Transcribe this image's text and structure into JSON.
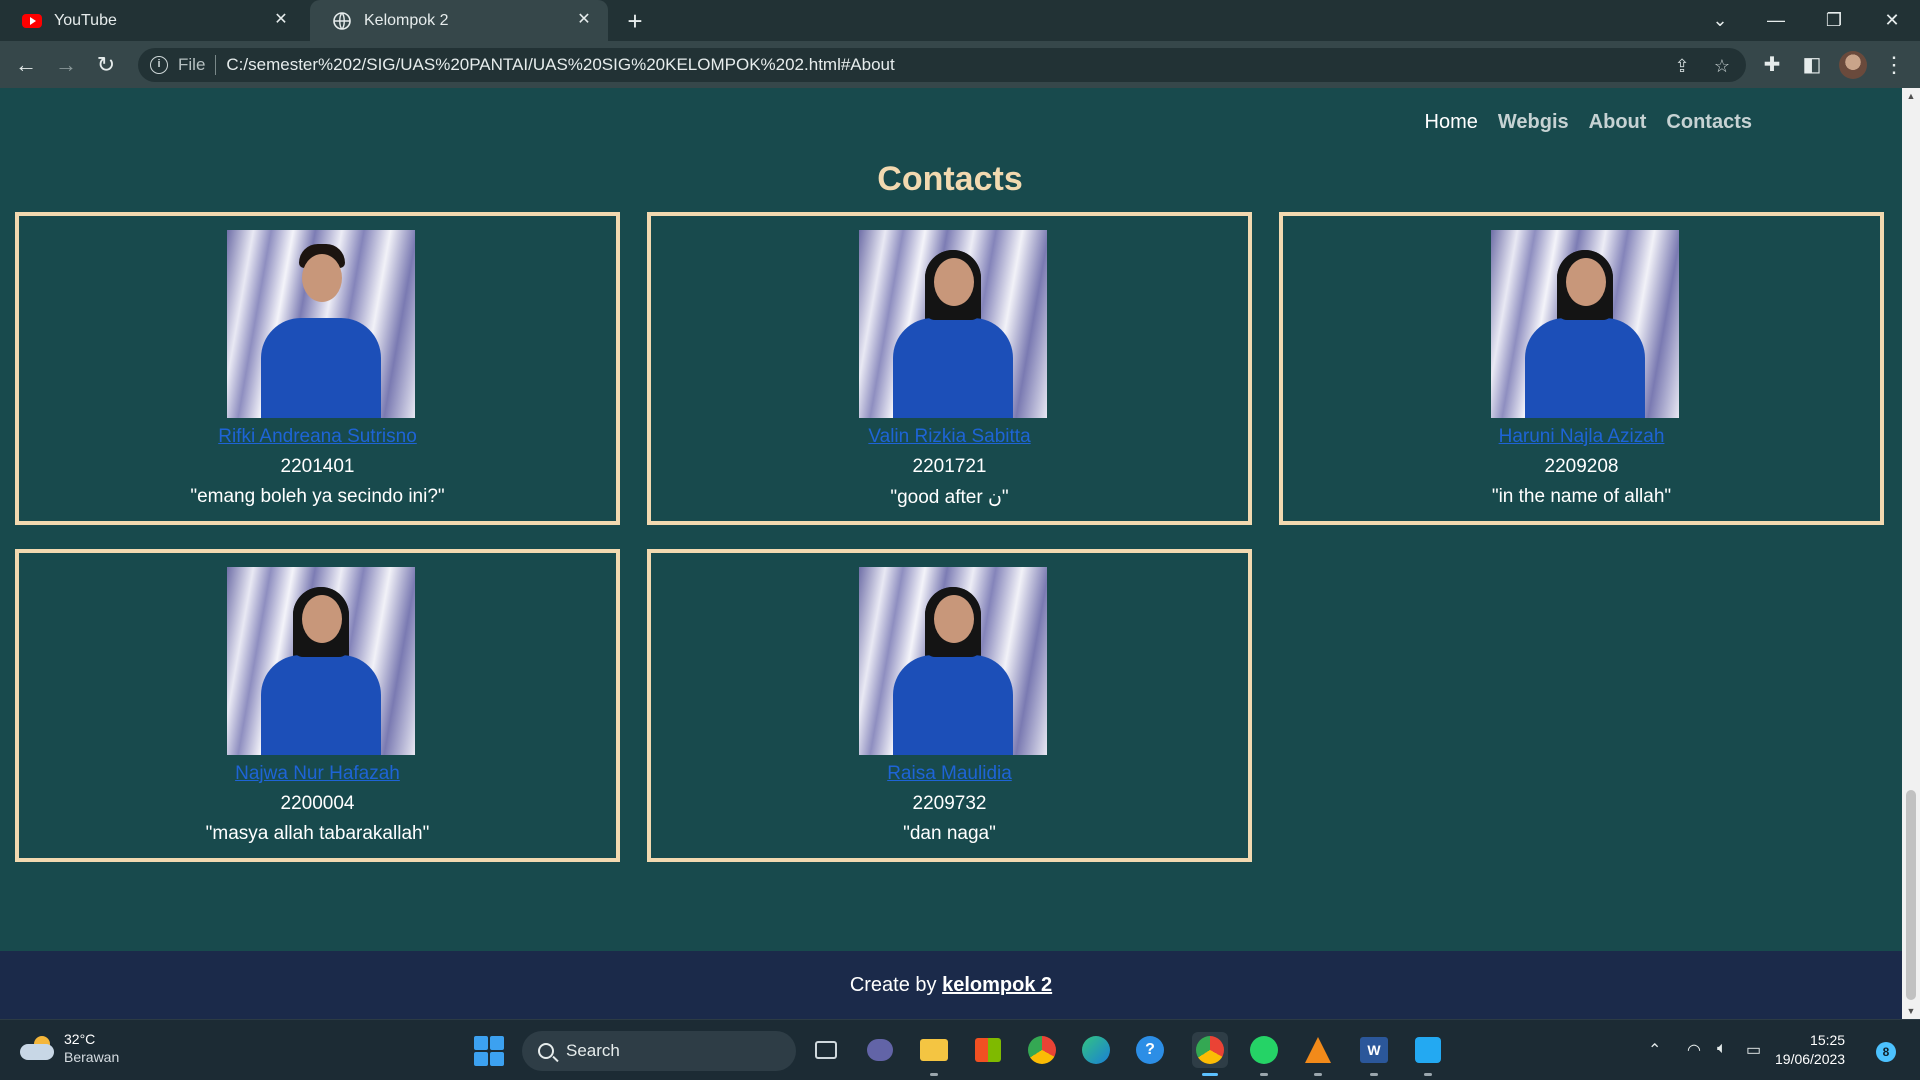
{
  "browser": {
    "tabs": [
      {
        "title": "YouTube",
        "active": false
      },
      {
        "title": "Kelompok 2",
        "active": true
      }
    ],
    "address": {
      "scheme_label": "File",
      "url": "C:/semester%202/SIG/UAS%20PANTAI/UAS%20SIG%20KELOMPOK%202.html#About"
    }
  },
  "page": {
    "nav": [
      {
        "label": "Home",
        "active": true
      },
      {
        "label": "Webgis",
        "active": false
      },
      {
        "label": "About",
        "active": false
      },
      {
        "label": "Contacts",
        "active": false
      }
    ],
    "section_title": "Contacts",
    "contacts": [
      {
        "name": "Rifki Andreana Sutrisno",
        "nim": "2201401",
        "quote": "\"emang boleh ya secindo ini?\"",
        "hijab": false
      },
      {
        "name": "Valin Rizkia Sabitta",
        "nim": "2201721",
        "quote": "\"good after ن\"",
        "hijab": true
      },
      {
        "name": "Haruni Najla Azizah",
        "nim": "2209208",
        "quote": "\"in the name of allah\"",
        "hijab": true
      },
      {
        "name": "Najwa Nur Hafazah",
        "nim": "2200004",
        "quote": "\"masya allah tabarakallah\"",
        "hijab": true
      },
      {
        "name": "Raisa Maulidia",
        "nim": "2209732",
        "quote": "\"dan naga\"",
        "hijab": true
      }
    ],
    "footer": {
      "prefix": "Create by",
      "link": "kelompok 2"
    }
  },
  "taskbar": {
    "weather": {
      "temp": "32°C",
      "condition": "Berawan"
    },
    "search_placeholder": "Search",
    "clock": {
      "time": "15:25",
      "date": "19/06/2023"
    },
    "notification_count": "8",
    "apps": [
      "task-view",
      "meet",
      "file-explorer",
      "store",
      "chrome",
      "edge",
      "help",
      "chrome-profile",
      "whatsapp",
      "vlc",
      "word",
      "vscode"
    ]
  },
  "colors": {
    "page_bg": "#184a4d",
    "accent": "#f2d9b0",
    "link": "#1e64d6",
    "footer_bg": "#1b2a4a"
  }
}
